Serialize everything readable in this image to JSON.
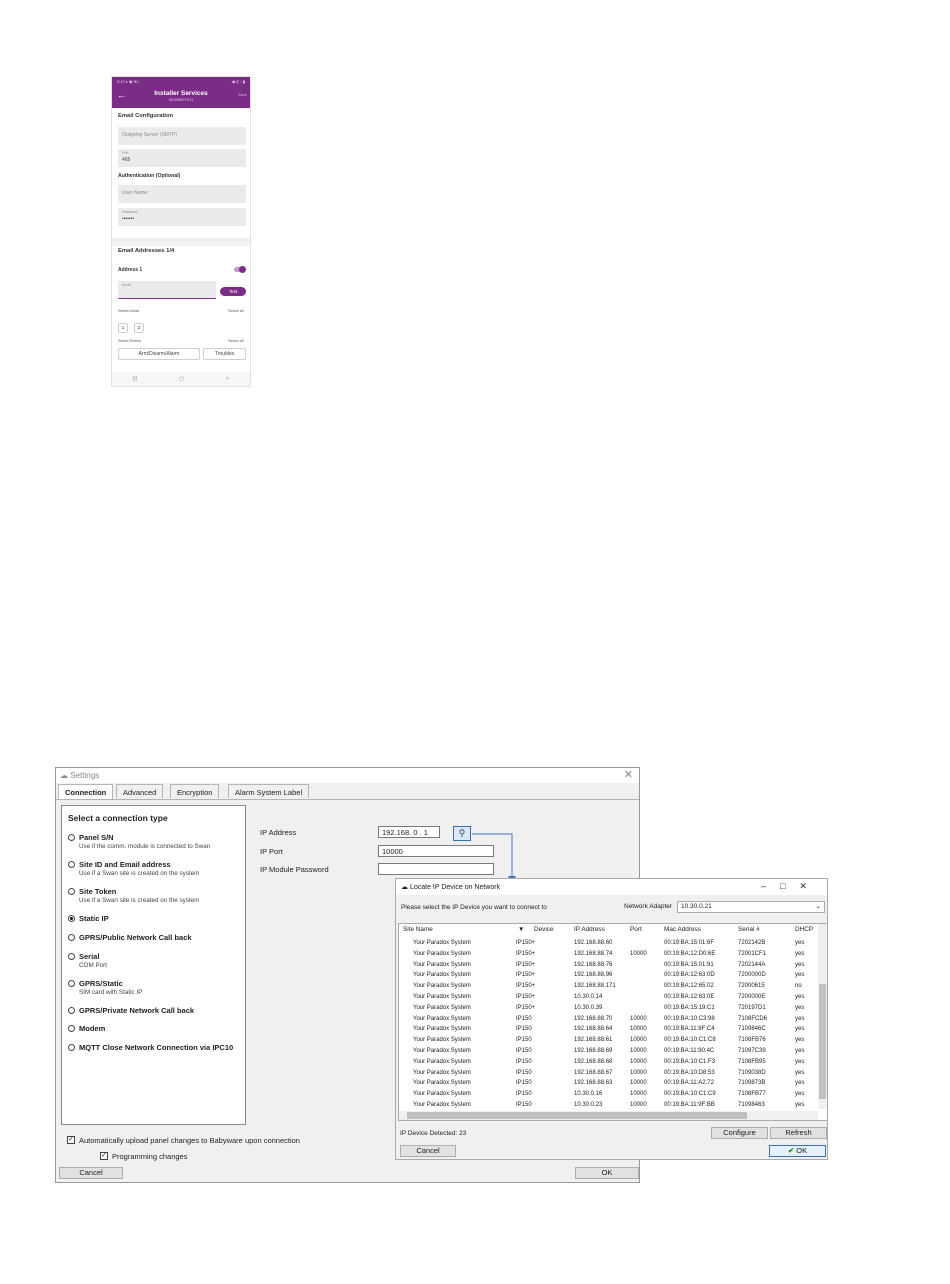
{
  "phone": {
    "status_left": "5:47 ▸ ◉ ✉ •",
    "status_right": "◀ ◎ ▫ ▮",
    "title": "Installer Services",
    "subtitle": "MG4080PTE74",
    "save": "Save",
    "email_config": "Email Configuration",
    "outgoing_server": "Outgoing Server (SMTP)",
    "port_label": "Port",
    "port_value": "465",
    "auth_heading": "Authentication (Optional)",
    "user_name": "User Name",
    "password_label": "Password",
    "password_value": "•••••••",
    "addresses_heading": "Email Addresses 1/4",
    "address1": "Address 1",
    "email_placeholder": "Email",
    "test_button": "Test",
    "select_areas": "Select Areas",
    "select_all_areas": "Select all",
    "area1": "1",
    "area2": "2",
    "select_events": "Select Events",
    "select_all_events": "Select all",
    "event1": "Arm/Disarm/Alarm",
    "event2": "Troubles",
    "nav": [
      "|||",
      "▢",
      "<"
    ]
  },
  "settings": {
    "title": "Settings",
    "tabs": [
      "Connection",
      "Advanced",
      "Encryption",
      "Alarm System Label"
    ],
    "select_heading": "Select a connection type",
    "options": [
      {
        "label": "Panel S/N",
        "sub": "Use if the comm. module is connected to Swan"
      },
      {
        "label": "Site ID and Email address",
        "sub": "Use if a Swan site is created on the system"
      },
      {
        "label": "Site Token",
        "sub": "Use if a Swan site is created on the system"
      },
      {
        "label": "Static IP",
        "sub": ""
      },
      {
        "label": "GPRS/Public Network Call back",
        "sub": ""
      },
      {
        "label": "Serial",
        "sub": "COM Port"
      },
      {
        "label": "GPRS/Static",
        "sub": "SIM card with Static IP"
      },
      {
        "label": "GPRS/Private Network Call back",
        "sub": ""
      },
      {
        "label": "Modem",
        "sub": ""
      },
      {
        "label": "MQTT Close Network Connection via IPC10",
        "sub": ""
      }
    ],
    "ip_address_label": "IP Address",
    "ip_address_value": "192.168. 0 . 1",
    "ip_port_label": "IP Port",
    "ip_port_value": "10000",
    "ip_password_label": "IP Module Password",
    "ip_password_value": "",
    "auto_upload": "Automatically upload panel changes to Babyware upon connection",
    "programming_changes": "Programming changes",
    "cancel": "Cancel",
    "ok": "OK"
  },
  "locate": {
    "title": "Locate IP Device on Network",
    "instruction": "Please select the IP Device you want to connect to",
    "adapter_label": "Network Adapter",
    "adapter_value": "10.30.0.21",
    "columns": [
      "Site Name",
      "Device",
      "IP Address",
      "Port",
      "Mac Address",
      "Serial #",
      "DHCP"
    ],
    "rows": [
      [
        "Your Paradox System",
        "IP150+",
        "192.168.88.60",
        "",
        "00:19:BA:15:01:6F",
        "7202142B",
        "yes"
      ],
      [
        "Your Paradox System",
        "IP150+",
        "192.168.88.74",
        "10000",
        "00:19:BA:12:D0:6E",
        "72001CF1",
        "yes"
      ],
      [
        "Your Paradox System",
        "IP150+",
        "192.168.88.76",
        "",
        "00:19:BA:15:01:91",
        "7202144A",
        "yes"
      ],
      [
        "Your Paradox System",
        "IP150+",
        "192.168.88.96",
        "",
        "00:19:BA:12:63:0D",
        "7200000D",
        "yes"
      ],
      [
        "Your Paradox System",
        "IP150+",
        "192.168.88.171",
        "",
        "00:19:BA:12:65:02",
        "72000615",
        "no"
      ],
      [
        "Your Paradox System",
        "IP150+",
        "10.30.0.14",
        "",
        "00:19:BA:12:63:0E",
        "7200000E",
        "yes"
      ],
      [
        "Your Paradox System",
        "IP150+",
        "10.30.0.39",
        "",
        "00:19:BA:15:19:C1",
        "720197D1",
        "yes"
      ],
      [
        "Your Paradox System",
        "IP150",
        "192.168.88.70",
        "10000",
        "00:19:BA:10:C3:98",
        "7108FCD6",
        "yes"
      ],
      [
        "Your Paradox System",
        "IP150",
        "192.168.88.64",
        "10000",
        "00:19:BA:11:9F:C4",
        "7109846C",
        "yes"
      ],
      [
        "Your Paradox System",
        "IP150",
        "192.168.88.61",
        "10000",
        "00:19:BA:10:C1:C8",
        "7108FB76",
        "yes"
      ],
      [
        "Your Paradox System",
        "IP150",
        "192.168.88.69",
        "10000",
        "00:19:BA:11:90:4C",
        "71097C39",
        "yes"
      ],
      [
        "Your Paradox System",
        "IP150",
        "192.168.88.68",
        "10000",
        "00:19:BA:10:C1:F3",
        "7108FB95",
        "yes"
      ],
      [
        "Your Paradox System",
        "IP150",
        "192.168.88.67",
        "10000",
        "00:19:BA:10:D8:53",
        "7109038D",
        "yes"
      ],
      [
        "Your Paradox System",
        "IP150",
        "192.168.88.63",
        "10000",
        "00:19:BA:11:A2:72",
        "7109873B",
        "yes"
      ],
      [
        "Your Paradox System",
        "IP150",
        "10.30.0.16",
        "10000",
        "00:19:BA:10:C1:C9",
        "7108FB77",
        "yes"
      ],
      [
        "Your Paradox System",
        "IP150",
        "10.30.0.23",
        "10000",
        "00:19:BA:11:9F:BB",
        "71098463",
        "yes"
      ]
    ],
    "detected": "IP Device Detected: 23",
    "configure": "Configure",
    "refresh": "Refresh",
    "cancel": "Cancel",
    "ok": "OK"
  }
}
